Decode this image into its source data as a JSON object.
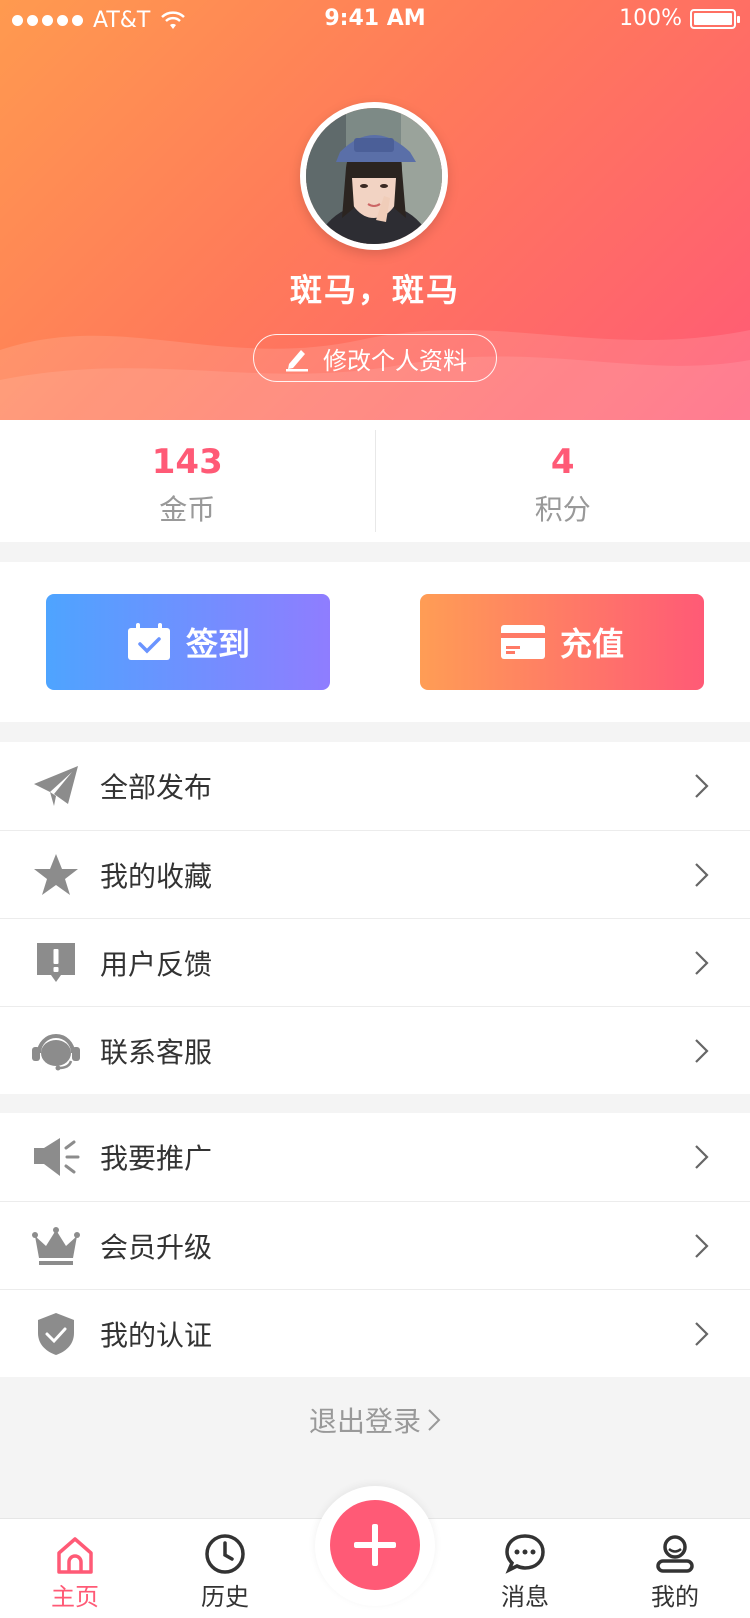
{
  "status_bar": {
    "carrier": "AT&T",
    "time": "9:41 AM",
    "battery": "100%"
  },
  "profile": {
    "name": "斑马，斑马",
    "edit_label": "修改个人资料"
  },
  "stats": [
    {
      "value": "143",
      "label": "金币"
    },
    {
      "value": "4",
      "label": "积分"
    }
  ],
  "actions": {
    "sign_in": "签到",
    "recharge": "充值"
  },
  "menu1": [
    {
      "label": "全部发布",
      "icon": "paper-plane-icon"
    },
    {
      "label": "我的收藏",
      "icon": "star-icon"
    },
    {
      "label": "用户反馈",
      "icon": "feedback-icon"
    },
    {
      "label": "联系客服",
      "icon": "headset-icon"
    }
  ],
  "menu2": [
    {
      "label": "我要推广",
      "icon": "megaphone-icon"
    },
    {
      "label": "会员升级",
      "icon": "crown-icon"
    },
    {
      "label": "我的认证",
      "icon": "shield-check-icon"
    }
  ],
  "logout": "退出登录",
  "tabs": [
    {
      "label": "主页",
      "icon": "home-icon",
      "active": true
    },
    {
      "label": "历史",
      "icon": "clock-icon",
      "active": false
    },
    {
      "label": "消息",
      "icon": "chat-icon",
      "active": false
    },
    {
      "label": "我的",
      "icon": "user-icon",
      "active": false
    }
  ],
  "colors": {
    "accent": "#ff5a76",
    "orange": "#ff9a4f",
    "blue": "#4ea4ff",
    "purple": "#8f7dff",
    "icon_gray": "#8c8c8c"
  }
}
